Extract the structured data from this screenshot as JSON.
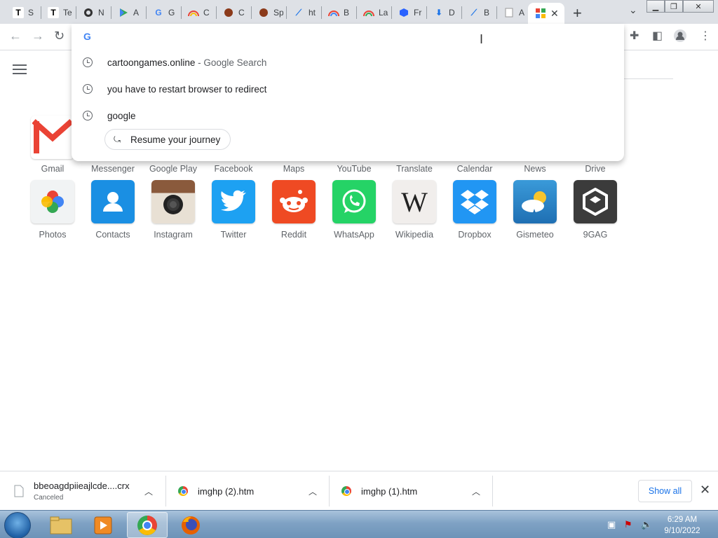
{
  "tabs": [
    {
      "title": "S",
      "icon": "T"
    },
    {
      "title": "Te",
      "icon": "T"
    },
    {
      "title": "N",
      "icon": "github"
    },
    {
      "title": "A",
      "icon": "play"
    },
    {
      "title": "G",
      "icon": "G"
    },
    {
      "title": "C",
      "icon": "rainbow"
    },
    {
      "title": "C",
      "icon": "mario"
    },
    {
      "title": "Sp",
      "icon": "mario"
    },
    {
      "title": "ht",
      "icon": "feather"
    },
    {
      "title": "B",
      "icon": "rainbow"
    },
    {
      "title": "La",
      "icon": "rainbow"
    },
    {
      "title": "Fr",
      "icon": "cube"
    },
    {
      "title": "D",
      "icon": "download"
    },
    {
      "title": "B",
      "icon": "feather"
    },
    {
      "title": "A",
      "icon": "page"
    }
  ],
  "omnibox": {
    "suggestions": [
      {
        "text": "cartoongames.online",
        "suffix": " - Google Search"
      },
      {
        "text": "you have to restart browser to redirect",
        "suffix": ""
      },
      {
        "text": "google",
        "suffix": ""
      }
    ],
    "journey_label": "Resume your journey"
  },
  "apps_row1_labels": [
    "Gmail",
    "Messenger",
    "Google Play",
    "Facebook",
    "Maps",
    "YouTube",
    "Translate",
    "Calendar",
    "News",
    "Drive"
  ],
  "apps_row2": [
    {
      "label": "Photos",
      "icon": "photos-icon"
    },
    {
      "label": "Contacts",
      "icon": "contacts-icon"
    },
    {
      "label": "Instagram",
      "icon": "instagram-icon"
    },
    {
      "label": "Twitter",
      "icon": "twitter-icon"
    },
    {
      "label": "Reddit",
      "icon": "reddit-icon"
    },
    {
      "label": "WhatsApp",
      "icon": "whatsapp-icon"
    },
    {
      "label": "Wikipedia",
      "icon": "wikipedia-icon"
    },
    {
      "label": "Dropbox",
      "icon": "dropbox-icon"
    },
    {
      "label": "Gismeteo",
      "icon": "gismeteo-icon"
    },
    {
      "label": "9GAG",
      "icon": "9gag-icon"
    }
  ],
  "downloads": [
    {
      "name": "bbeoagdpiieajlcde....crx",
      "status": "Canceled"
    },
    {
      "name": "imghp (2).htm",
      "status": ""
    },
    {
      "name": "imghp (1).htm",
      "status": ""
    }
  ],
  "download_bar": {
    "show_all": "Show all"
  },
  "taskbar": {
    "time": "6:29 AM",
    "date": "9/10/2022"
  }
}
